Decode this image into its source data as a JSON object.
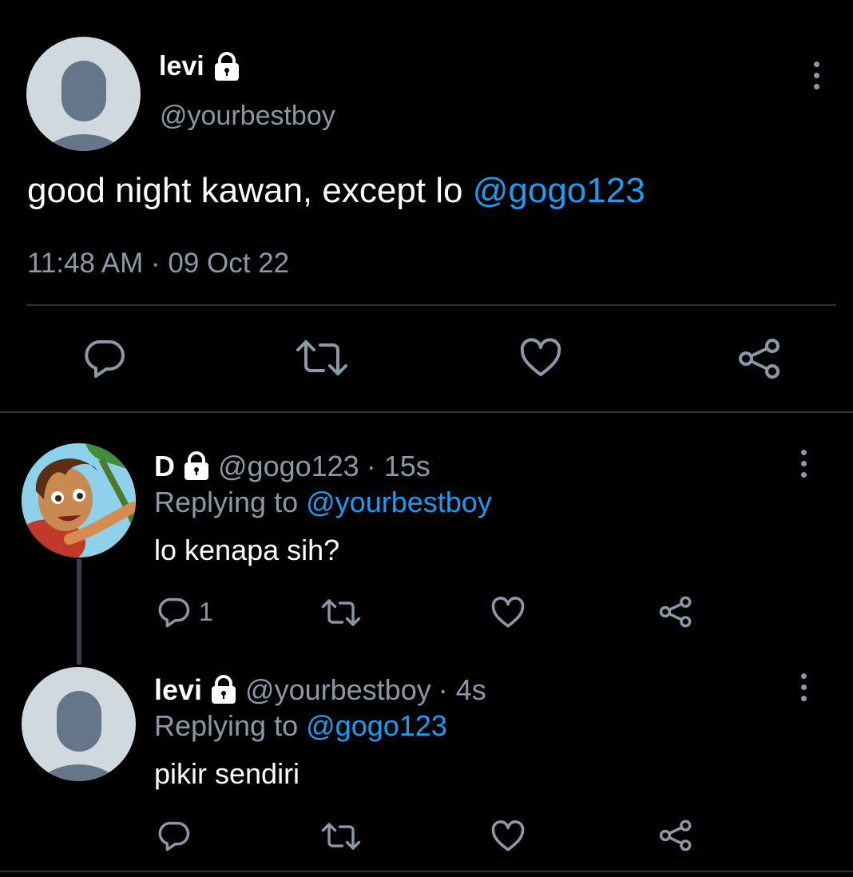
{
  "main_tweet": {
    "display_name": "levi",
    "handle": "@yourbestboy",
    "text": "good night kawan, except lo ",
    "mention": "@gogo123",
    "timestamp": "11:48 AM · 09 Oct 22",
    "icons": [
      "reply-icon",
      "retweet-icon",
      "like-icon",
      "share-icon",
      "more-icon",
      "lock-icon"
    ]
  },
  "replies": [
    {
      "display_name": "D",
      "handle": "@gogo123",
      "time": "· 15s",
      "replying_label": "Replying to",
      "replying_to": "@yourbestboy",
      "text": "lo kenapa sih?",
      "reply_count": "1"
    },
    {
      "display_name": "levi",
      "handle": "@yourbestboy",
      "time": "· 4s",
      "replying_label": "Replying to",
      "replying_to": "@gogo123",
      "text": "pikir sendiri",
      "reply_count": ""
    }
  ],
  "colors": {
    "background": "#000000",
    "text": "#e7e9ea",
    "secondary": "#8b98a5",
    "link": "#1d9bf0",
    "divider": "#2f3336"
  }
}
